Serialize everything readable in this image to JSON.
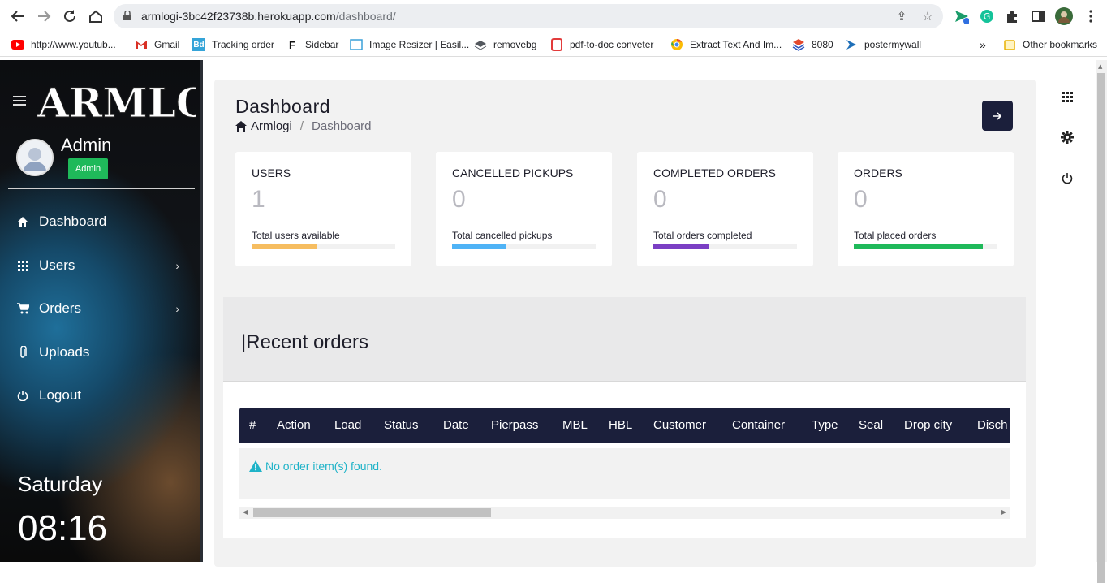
{
  "browser": {
    "url_host": "armlogi-3bc42f23738b.herokuapp.com",
    "url_path": "/dashboard/",
    "bookmarks": [
      {
        "label": "http://www.youtub...",
        "icon": "youtube-icon"
      },
      {
        "label": "Gmail",
        "icon": "gmail-icon"
      },
      {
        "label": "Tracking order",
        "icon": "bd-icon"
      },
      {
        "label": "Sidebar",
        "icon": "f-icon"
      },
      {
        "label": "Image Resizer | Easil...",
        "icon": "image-icon"
      },
      {
        "label": "removebg",
        "icon": "layers-icon"
      },
      {
        "label": "pdf-to-doc conveter",
        "icon": "pdf-icon"
      },
      {
        "label": "Extract Text And Im...",
        "icon": "chrome-icon"
      },
      {
        "label": "8080",
        "icon": "stack-icon"
      },
      {
        "label": "postermywall",
        "icon": "arrow-icon"
      }
    ],
    "more_label": "»",
    "other_bookmarks": "Other bookmarks"
  },
  "sidebar": {
    "logo_text": "ARMLOGI",
    "user_name": "Admin",
    "user_role": "Admin",
    "menu": [
      {
        "label": "Dashboard",
        "icon": "home-icon",
        "has_chevron": false
      },
      {
        "label": "Users",
        "icon": "grid-icon",
        "has_chevron": true
      },
      {
        "label": "Orders",
        "icon": "cart-icon",
        "has_chevron": true
      },
      {
        "label": "Uploads",
        "icon": "paperclip-icon",
        "has_chevron": false
      },
      {
        "label": "Logout",
        "icon": "power-icon",
        "has_chevron": false
      }
    ],
    "chevron": "›",
    "day": "Saturday",
    "time": "08:16"
  },
  "header": {
    "title": "Dashboard",
    "breadcrumb_home": "Armlogi",
    "breadcrumb_sep": "/",
    "breadcrumb_current": "Dashboard"
  },
  "cards": [
    {
      "title": "USERS",
      "value": "1",
      "desc": "Total users available",
      "progress": 0.45,
      "color": "#f6bd60"
    },
    {
      "title": "CANCELLED PICKUPS",
      "value": "0",
      "desc": "Total cancelled pickups",
      "progress": 0.38,
      "color": "#4fb3f6"
    },
    {
      "title": "COMPLETED ORDERS",
      "value": "0",
      "desc": "Total orders completed",
      "progress": 0.39,
      "color": "#7b3fc4"
    },
    {
      "title": "ORDERS",
      "value": "0",
      "desc": "Total placed orders",
      "progress": 0.9,
      "color": "#1fb95a"
    }
  ],
  "recent": {
    "title": "|Recent orders",
    "columns": [
      "#",
      "Action",
      "Load",
      "Status",
      "Date",
      "Pierpass",
      "MBL",
      "HBL",
      "Customer",
      "Container",
      "Type",
      "Seal",
      "Drop city",
      "Disch"
    ],
    "empty_message": "No order item(s) found."
  },
  "scrollbar": {
    "left_arrow": "◀",
    "right_arrow": "▶",
    "up_arrow": "▲"
  }
}
